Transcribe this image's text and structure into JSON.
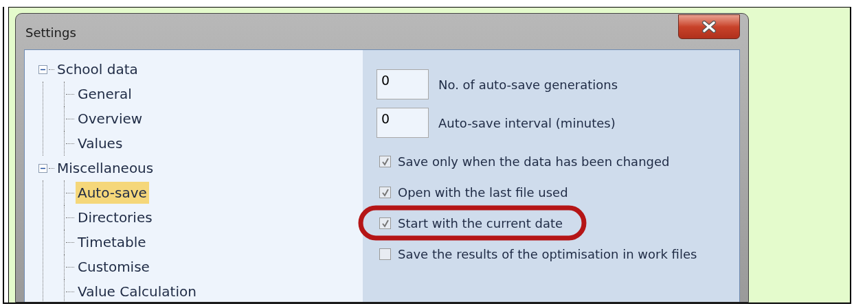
{
  "window": {
    "title": "Settings"
  },
  "tree": [
    {
      "label": "School data",
      "expanded": true,
      "selected": false,
      "children": [
        {
          "label": "General",
          "selected": false
        },
        {
          "label": "Overview",
          "selected": false
        },
        {
          "label": "Values",
          "selected": false
        }
      ]
    },
    {
      "label": "Miscellaneous",
      "expanded": true,
      "selected": false,
      "children": [
        {
          "label": "Auto-save",
          "selected": true
        },
        {
          "label": "Directories",
          "selected": false
        },
        {
          "label": "Timetable",
          "selected": false
        },
        {
          "label": "Customise",
          "selected": false
        },
        {
          "label": "Value Calculation",
          "selected": false
        }
      ]
    }
  ],
  "options": [
    {
      "kind": "number",
      "value": "0",
      "label": "No. of auto-save generations"
    },
    {
      "kind": "number",
      "value": "0",
      "label": "Auto-save interval (minutes)"
    },
    {
      "kind": "checkbox",
      "checked": true,
      "label": "Save only when the data has been changed"
    },
    {
      "kind": "checkbox",
      "checked": true,
      "label": "Open with the last file used"
    },
    {
      "kind": "checkbox",
      "checked": true,
      "label": "Start with the current date"
    },
    {
      "kind": "checkbox",
      "checked": false,
      "label": "Save the results of the optimisation in work files"
    }
  ]
}
